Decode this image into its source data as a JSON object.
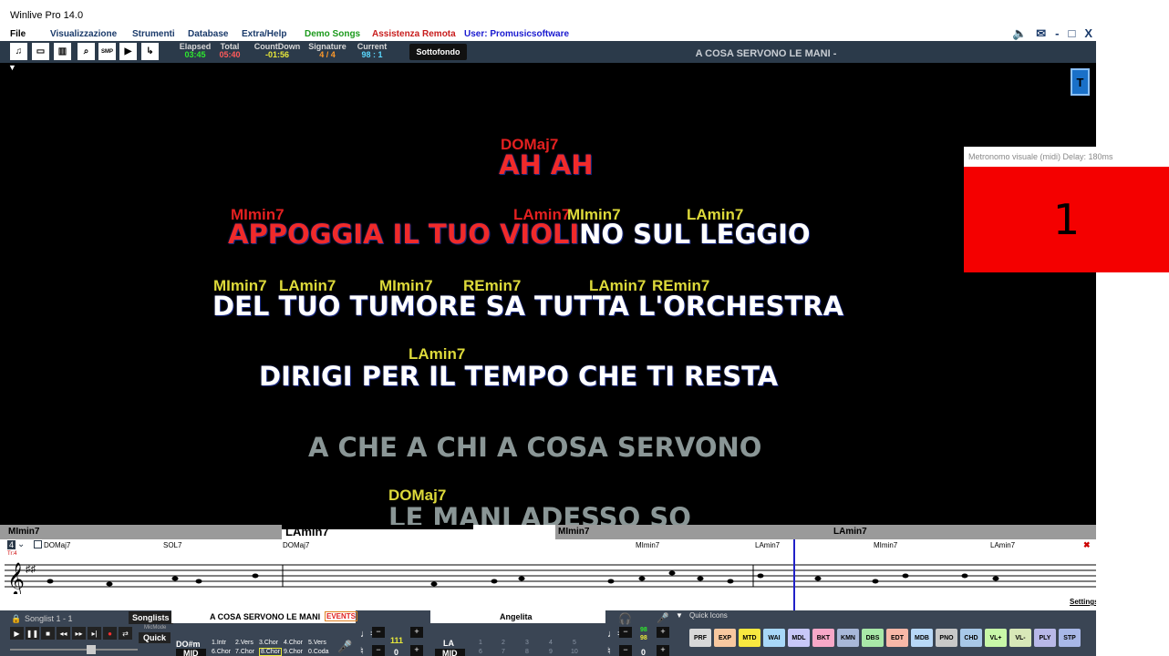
{
  "window": {
    "title": "Winlive Pro 14.0"
  },
  "menu": [
    {
      "label": "File",
      "color": "#000000"
    },
    {
      "label": "Visualizzazione",
      "color": "#1a3a6a"
    },
    {
      "label": "Strumenti",
      "color": "#1a3a6a"
    },
    {
      "label": "Database",
      "color": "#1a3a6a"
    },
    {
      "label": "Extra/Help",
      "color": "#1a3a6a"
    },
    {
      "label": "Demo Songs",
      "color": "#1c9a1c"
    },
    {
      "label": "Assistenza Remota",
      "color": "#c81c1c"
    },
    {
      "label": "User: Promusicsoftware",
      "color": "#1a1ad0"
    }
  ],
  "window_controls": {
    "speaker_icon": "speaker-icon",
    "mail_icon": "mail-icon",
    "min": "-",
    "restore": "□",
    "close": "X"
  },
  "toolbar": {
    "smp_label": "SMP",
    "stats": [
      {
        "label": "Elapsed",
        "value": "03:45",
        "color": "#2ee82e"
      },
      {
        "label": "Total",
        "value": "05:40",
        "color": "#ff5a5a"
      },
      {
        "label": "CountDown",
        "value": "-01:56",
        "color": "#e8e83a"
      },
      {
        "label": "Signature",
        "value": "4 / 4",
        "color": "#ff9a2a"
      },
      {
        "label": "Current",
        "value": "98 : 1",
        "color": "#5ad8ff"
      }
    ],
    "sottofondo": "Sottofondo",
    "song_title": "A COSA SERVONO LE MANI -"
  },
  "lyrics": {
    "lines": [
      {
        "text": "AH AH",
        "sung": "AH AH",
        "rest": "",
        "chords": [
          {
            "name": "DOMaj7",
            "red": true
          }
        ]
      },
      {
        "text": "APPOGGIA IL TUO VIOLINO SUL LEGGIO",
        "sung": "APPOGGIA IL TUO VIOLI",
        "rest": "NO SUL LEGGIO",
        "chords": [
          {
            "name": "MImin7",
            "red": true
          },
          {
            "name": "LAmin7",
            "red": true
          },
          {
            "name": "MImin7",
            "red": false
          },
          {
            "name": "LAmin7",
            "red": false
          }
        ]
      },
      {
        "text": "DEL TUO TUMORE SA TUTTA L'ORCHESTRA",
        "sung": "",
        "rest": "DEL TUO TUMORE SA TUTTA L'ORCHESTRA",
        "chords": [
          {
            "name": "MImin7"
          },
          {
            "name": "LAmin7"
          },
          {
            "name": "MImin7"
          },
          {
            "name": "REmin7"
          },
          {
            "name": "LAmin7"
          },
          {
            "name": "REmin7"
          }
        ]
      },
      {
        "text": "DIRIGI PER IL TEMPO CHE TI RESTA",
        "sung": "",
        "rest": "DIRIGI PER IL TEMPO CHE TI RESTA",
        "chords": [
          {
            "name": "LAmin7"
          }
        ]
      },
      {
        "text": "A CHE A CHI A COSA SERVONO",
        "sung": "",
        "rest": "A CHE A CHI A COSA SERVONO",
        "chords": []
      },
      {
        "text": "LE MANI ADESSO SO",
        "sung": "",
        "rest": "LE MANI ADESSO SO",
        "chords": [
          {
            "name": "DOMaj7"
          }
        ]
      }
    ],
    "t_button": "T"
  },
  "metronome": {
    "title": "Metronomo visuale (midi) Delay: 180ms",
    "beat": "1",
    "color": "#f40000"
  },
  "chord_bar": {
    "chords": [
      "MImin7",
      "LAmin7",
      "MImin7",
      "LAmin7"
    ],
    "progress": 0.7
  },
  "staff": {
    "measure": "4",
    "tr": "Tr:4",
    "chords": [
      "DOMaj7",
      "SOL7",
      "DOMaj7",
      "MImin7",
      "LAmin7",
      "MImin7",
      "LAmin7"
    ],
    "settings": "Settings"
  },
  "bottom": {
    "songlist": "Songlist 1 - 1",
    "songlists_btn": "Songlists",
    "micmode": "MicMode",
    "quick": "Quick",
    "song_name": "A COSA SERVONO LE MANI",
    "events": "EVENTS",
    "key_label": "DO#m",
    "mid_label": "MID",
    "sections": [
      "1.Intr",
      "2.Vers",
      "3.Chor",
      "4.Chor",
      "5.Vers",
      "6.Chor",
      "7.Chor",
      "8.Chor",
      "9.Chor",
      "0.Coda"
    ],
    "active_section": "8.Chor",
    "tempo": "111",
    "transpose": "0",
    "singer": "Angelita",
    "key2": "LA",
    "mid2": "MID",
    "numbers_top": [
      "1",
      "2",
      "3",
      "4",
      "5"
    ],
    "numbers_bottom": [
      "6",
      "7",
      "8",
      "9",
      "10"
    ],
    "vol1": "98",
    "vol2": "98",
    "trans2": "0",
    "quick_icons_title": "Quick Icons",
    "quick_icons": [
      {
        "label": "PRF",
        "color": "#d8d8d8"
      },
      {
        "label": "EXP",
        "color": "#f8c8a0"
      },
      {
        "label": "MTD",
        "color": "#f8e840"
      },
      {
        "label": "WAI",
        "color": "#a8d8f8"
      },
      {
        "label": "MDL",
        "color": "#c8c8f8"
      },
      {
        "label": "BKT",
        "color": "#f8a8c8"
      },
      {
        "label": "KMN",
        "color": "#a8b8d8"
      },
      {
        "label": "DBS",
        "color": "#a8e8a8"
      },
      {
        "label": "EDT",
        "color": "#f8b8a8"
      },
      {
        "label": "MDB",
        "color": "#b8d8f8"
      },
      {
        "label": "PNO",
        "color": "#c8c8c8"
      },
      {
        "label": "CHD",
        "color": "#a8c8e8"
      },
      {
        "label": "VL+",
        "color": "#c8f8a8"
      },
      {
        "label": "VL-",
        "color": "#d8e8b8"
      },
      {
        "label": "PLY",
        "color": "#b8b8e8"
      },
      {
        "label": "STP",
        "color": "#a8b8e8"
      }
    ]
  }
}
